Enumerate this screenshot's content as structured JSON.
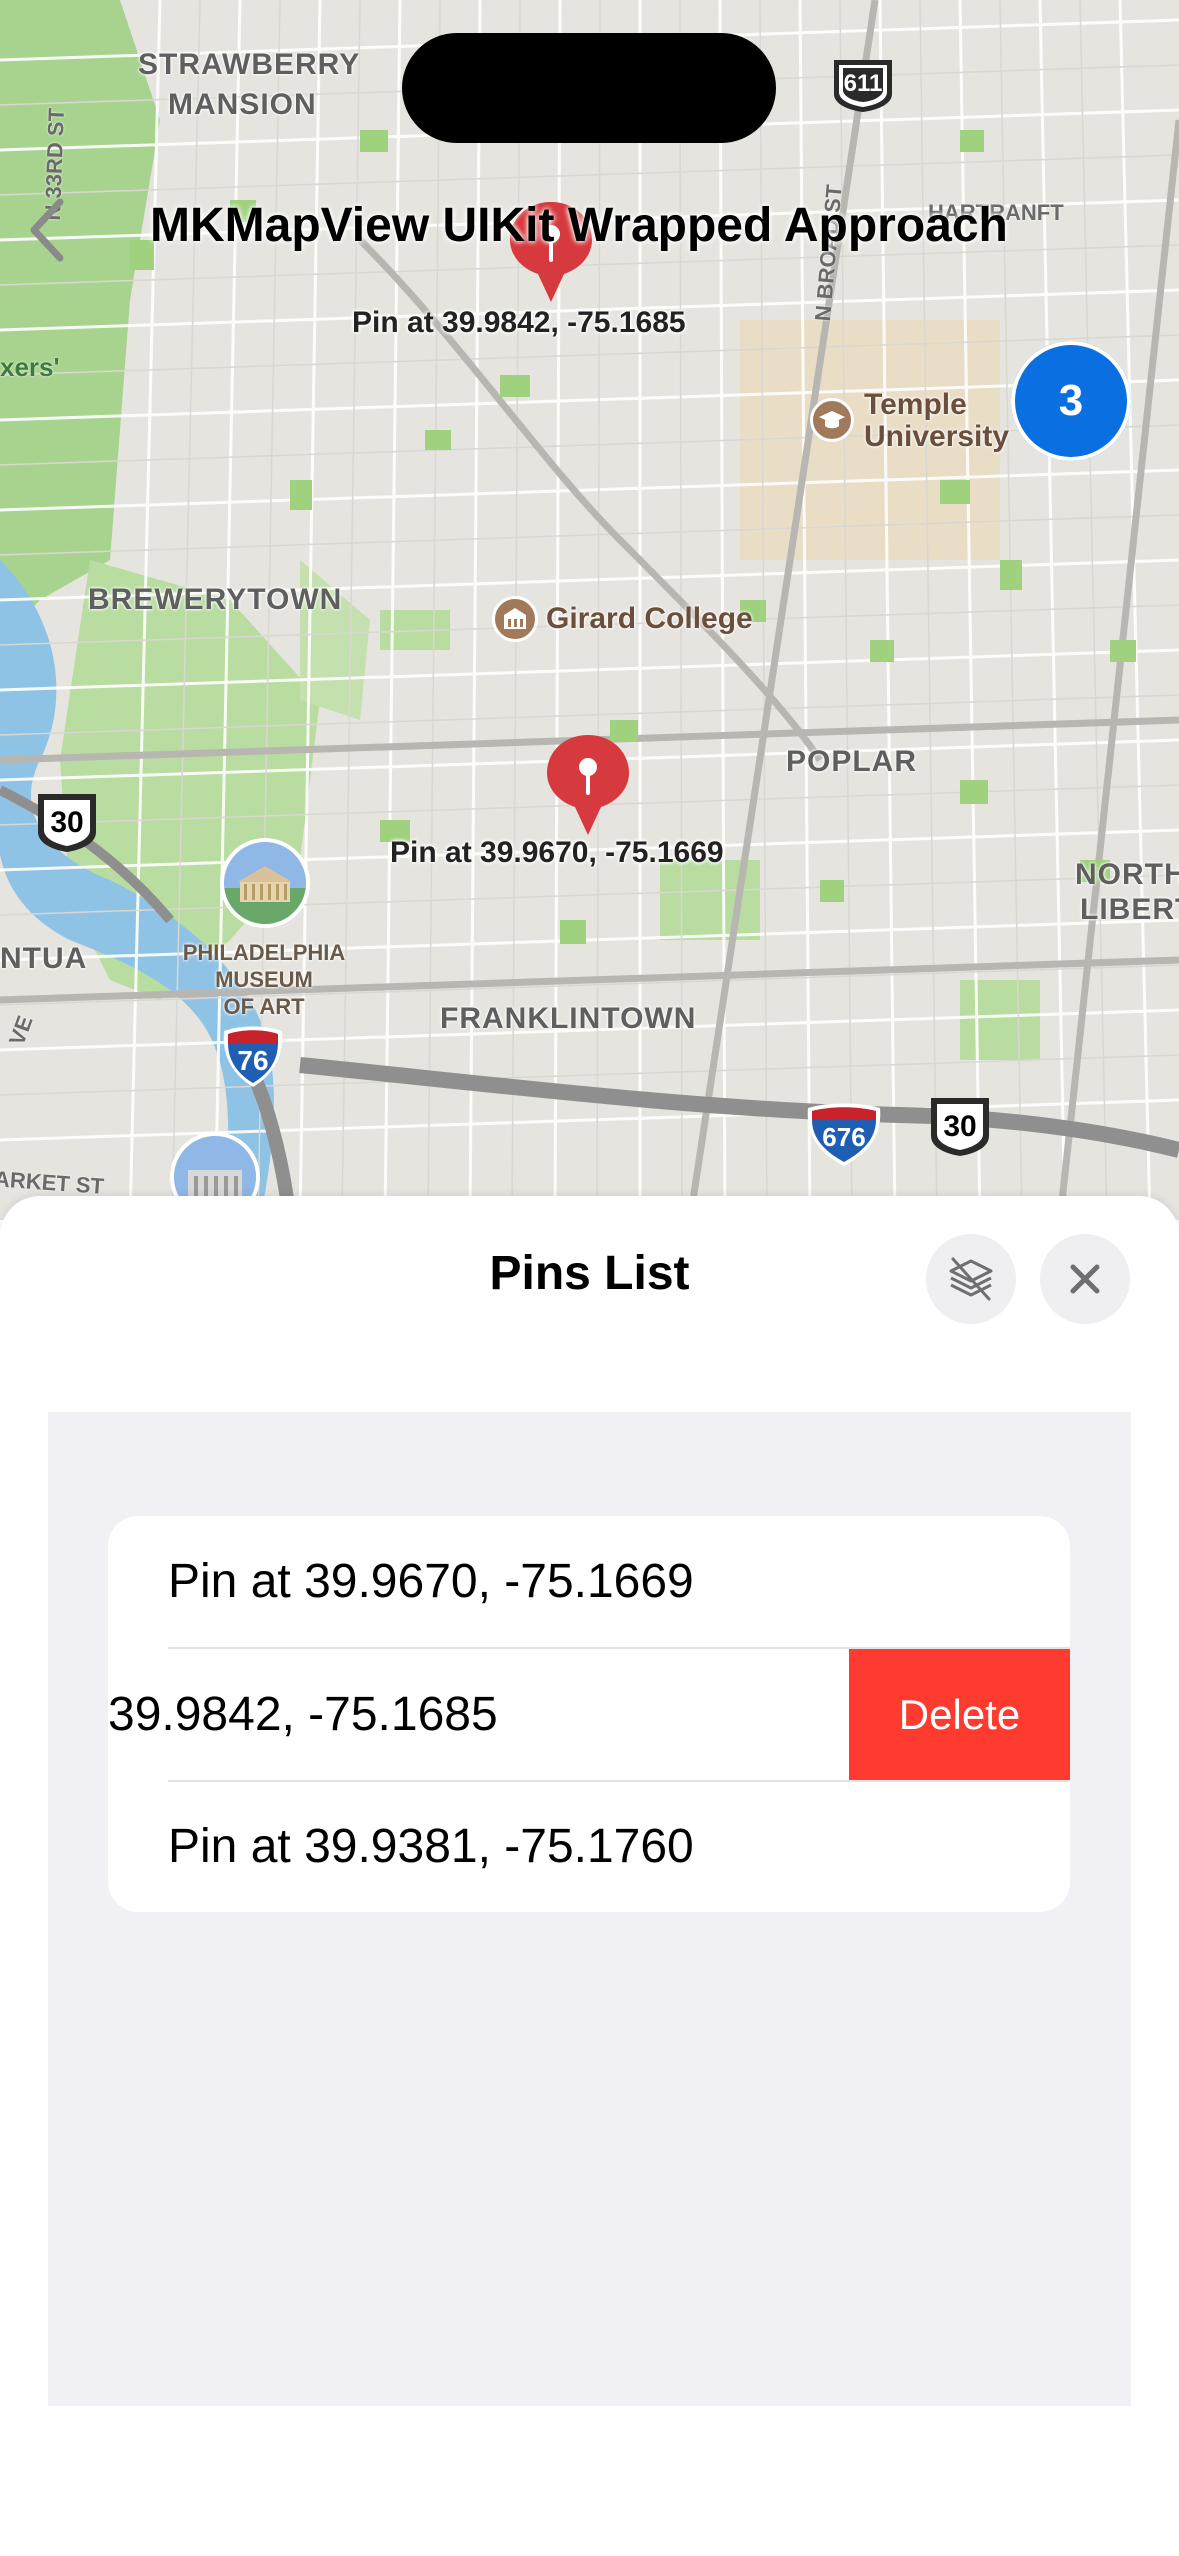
{
  "map": {
    "areas": [
      "STRAWBERRY",
      "MANSION",
      "BREWERYTOWN",
      "POPLAR",
      "FRANKLINTOWN",
      "NORTH",
      "LIBERT",
      "NTUA"
    ],
    "pois": {
      "temple_line1": "Temple",
      "temple_line2": "University",
      "girard": "Girard College",
      "museum_line1": "PHILADELPHIA",
      "museum_line2": "MUSEUM",
      "museum_line3": "OF ART"
    },
    "streets": {
      "n33rd": "N 33RD ST",
      "nbroad": "N BROAD ST",
      "market": "ARKET ST",
      "hartranft": "HARTRANFT",
      "xers": "xers'",
      "ve": "VE"
    },
    "shields": {
      "pa611": "611",
      "us30a": "30",
      "i76": "76",
      "i676": "676",
      "us30b": "30"
    },
    "pins": [
      {
        "label": "Pin at 39.9842, -75.1685"
      },
      {
        "label": "Pin at 39.9670, -75.1669"
      }
    ],
    "cluster_count": "3",
    "pin_color": "#d63a3f"
  },
  "nav": {
    "title": "MKMapView UIKit Wrapped Approach",
    "back_icon": "chevron-left-icon"
  },
  "sheet": {
    "title": "Pins List",
    "layers_icon": "layers-icon",
    "close_icon": "close-icon",
    "rows": [
      {
        "text": "Pin at 39.9670, -75.1669"
      },
      {
        "text": "39.9842, -75.1685",
        "delete_label": "Delete"
      },
      {
        "text": "Pin at 39.9381, -75.1760"
      }
    ],
    "delete_color": "#ff3b30"
  }
}
